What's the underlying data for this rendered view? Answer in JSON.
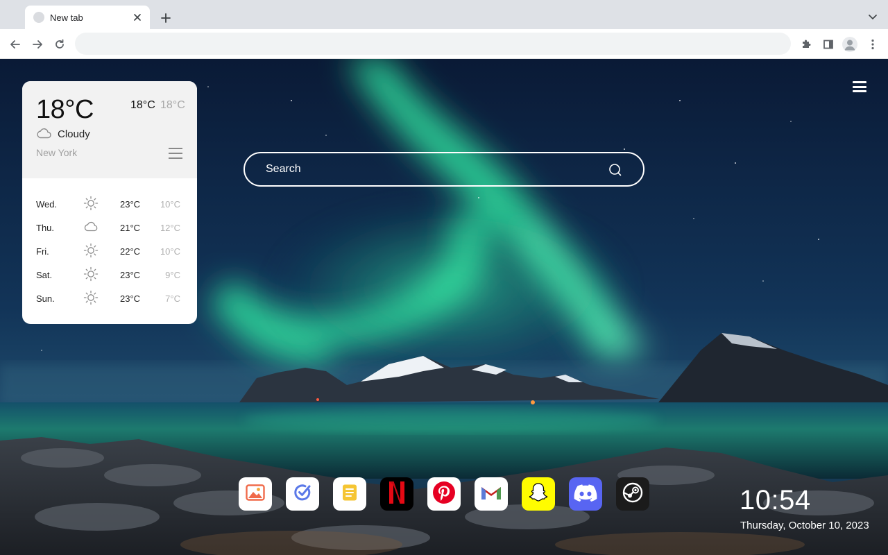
{
  "browser": {
    "tab": {
      "title": "New tab"
    },
    "omnibox": {
      "value": ""
    }
  },
  "weather": {
    "current_temp": "18°C",
    "high": "18°C",
    "low": "18°C",
    "condition": "Cloudy",
    "condition_icon": "cloud-icon",
    "city": "New York",
    "forecast": [
      {
        "day": "Wed.",
        "icon": "sun-icon",
        "high": "23°C",
        "low": "10°C"
      },
      {
        "day": "Thu.",
        "icon": "cloud-icon",
        "high": "21°C",
        "low": "12°C"
      },
      {
        "day": "Fri.",
        "icon": "sun-icon",
        "high": "22°C",
        "low": "10°C"
      },
      {
        "day": "Sat.",
        "icon": "sun-icon",
        "high": "23°C",
        "low": "9°C"
      },
      {
        "day": "Sun.",
        "icon": "sun-icon",
        "high": "23°C",
        "low": "7°C"
      }
    ]
  },
  "search": {
    "placeholder": "Search"
  },
  "dock": [
    {
      "name": "photos-app",
      "icon": "photos-icon",
      "bg": "#ffffff"
    },
    {
      "name": "tasks-app",
      "icon": "check-circle-icon",
      "bg": "#ffffff"
    },
    {
      "name": "notes-app",
      "icon": "notes-icon",
      "bg": "#ffffff"
    },
    {
      "name": "netflix-app",
      "icon": "netflix-icon",
      "bg": "#000000"
    },
    {
      "name": "pinterest-app",
      "icon": "pinterest-icon",
      "bg": "#ffffff"
    },
    {
      "name": "gmail-app",
      "icon": "gmail-icon",
      "bg": "#ffffff"
    },
    {
      "name": "snapchat-app",
      "icon": "snapchat-icon",
      "bg": "#fffc00"
    },
    {
      "name": "discord-app",
      "icon": "discord-icon",
      "bg": "#5865f2"
    },
    {
      "name": "steam-app",
      "icon": "steam-icon",
      "bg": "#1b1b1b"
    }
  ],
  "clock": {
    "time": "10:54",
    "date": "Thursday, October 10, 2023"
  }
}
